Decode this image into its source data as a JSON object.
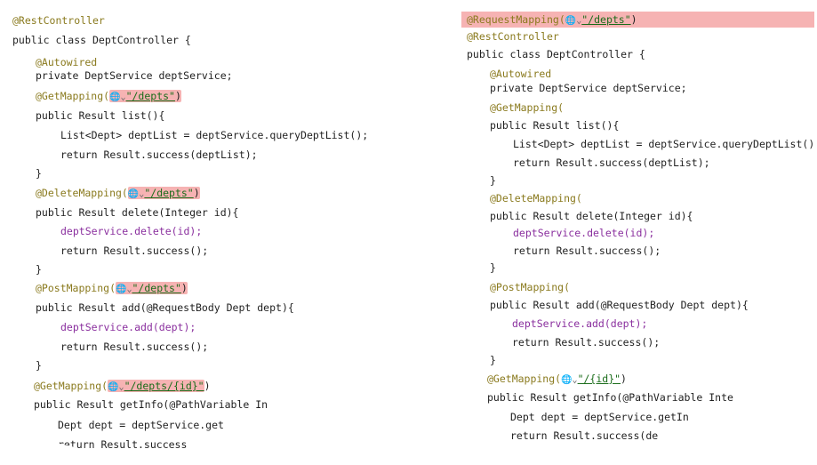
{
  "left": {
    "lines": [
      "@RestController",
      "public class DeptController {",
      "@Autowired",
      "private DeptService deptService;",
      "@GetMapping(",
      "\"/depts\"",
      ")",
      "public Result list(){",
      "List<Dept> deptList = deptService.queryDeptList();",
      "return Result.success(deptList);",
      "}",
      "@DeleteMapping(",
      "public Result delete(Integer id){",
      "deptService.delete(id);",
      "return Result.success();",
      "@PostMapping(",
      "public Result add(@RequestBody Dept dept){",
      "deptService.add(dept);",
      "@GetMapping(",
      "\"/depts/{id}\"",
      "public Result getInfo(@PathVariable In",
      "Dept dept = deptService.get",
      "return Result.success"
    ]
  },
  "right": {
    "request_mapping": "@RequestMapping(",
    "path": "\"/depts\"",
    "get_id_path": "\"/{id}\"",
    "getinfo_line": "public Result getInfo(@PathVariable Inte",
    "dept_line": "Dept dept = deptService.getIn",
    "return_line": "return Result.success(de"
  },
  "icons": {
    "globe": "globe-icon",
    "chevron": "chevron-down-icon"
  },
  "colors": {
    "highlight": "#f6b3b3",
    "annotation": "#8a7a1e",
    "field": "#8a2f9e"
  }
}
